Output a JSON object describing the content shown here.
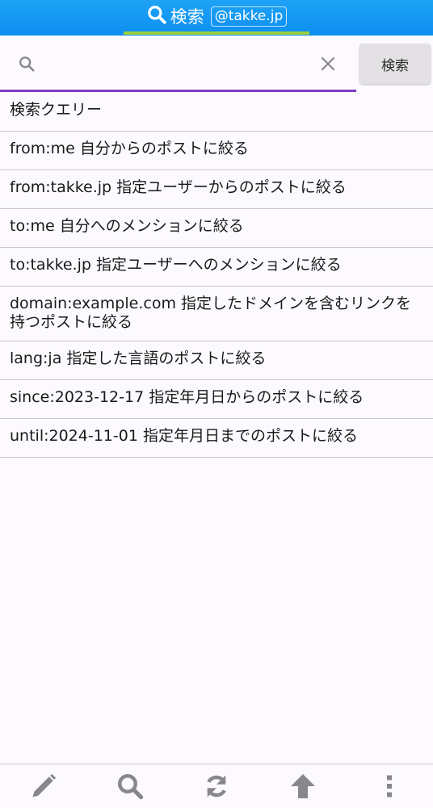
{
  "header": {
    "title": "検索",
    "account": "@takke.jp",
    "icon": "search-icon"
  },
  "search": {
    "value": "",
    "placeholder": "",
    "button_label": "検索"
  },
  "queries": [
    "検索クエリー",
    "from:me 自分からのポストに絞る",
    "from:takke.jp 指定ユーザーからのポストに絞る",
    "to:me 自分へのメンションに絞る",
    "to:takke.jp 指定ユーザーへのメンションに絞る",
    "domain:example.com 指定したドメインを含むリンクを持つポストに絞る",
    "lang:ja 指定した言語のポストに絞る",
    "since:2023-12-17 指定年月日からのポストに絞る",
    "until:2024-11-01 指定年月日までのポストに絞る"
  ],
  "bottom_bar": [
    "pencil-icon",
    "search-icon",
    "refresh-icon",
    "arrow-up-icon",
    "more-vertical-icon"
  ],
  "colors": {
    "header_bg": "#1ea3f6",
    "header_accent": "#9ccf3e",
    "input_underline": "#7e3cc2",
    "icon_gray": "#8a878c"
  }
}
